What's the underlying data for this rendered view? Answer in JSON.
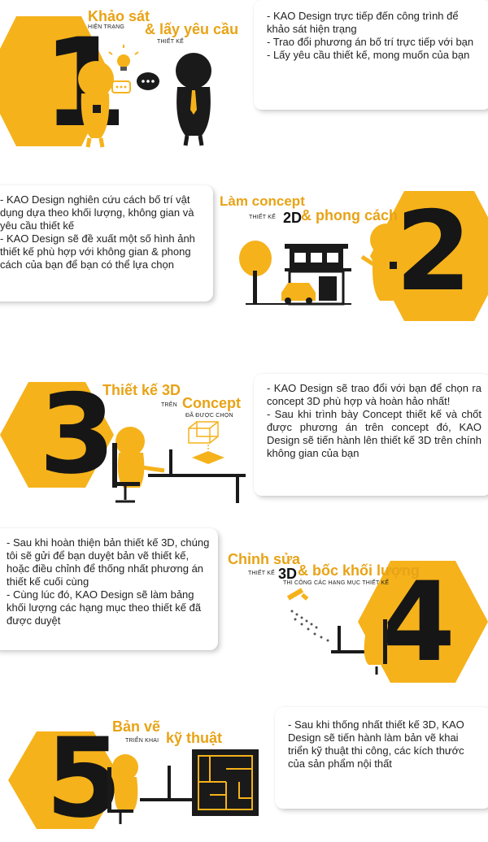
{
  "colors": {
    "accent": "#f5b21b",
    "title": "#e8a316",
    "dark": "#161616"
  },
  "steps": [
    {
      "number": "1",
      "title_main": "Khảo sát",
      "title_sub1": "HIỆN TRẠNG",
      "title_main2": "& lấy yêu cầu",
      "title_sub2": "THIẾT KẾ",
      "lines": [
        "-  KAO Design trực tiếp đến công trình để khảo sát hiện trạng",
        "- Trao đổi phương án bố trí trực tiếp với bạn",
        "- Lấy yêu cầu thiết kế, mong muốn của bạn"
      ]
    },
    {
      "number": "2",
      "title_main": "Làm concept",
      "title_sub1": "THIẾT KẾ",
      "title_main2": "2D",
      "title_main3": "& phong cách",
      "lines": [
        "- KAO Design nghiên cứu cách bố trí vật dụng dựa theo khối lượng, không gian và yêu cầu thiết kế",
        "- KAO Design sẽ đề xuất một số hình ảnh thiết kế phù hợp với không gian & phong cách của bạn để bạn có thể lựa chọn"
      ]
    },
    {
      "number": "3",
      "title_main": "Thiết kế 3D",
      "title_sub1": "TRÊN",
      "title_main2": "Concept",
      "title_sub2": "ĐÃ ĐƯỢC CHỌN",
      "lines": [
        "- KAO Design sẽ trao đổi với bạn để chọn ra concept 3D phù hợp và hoàn hảo nhất!",
        "- Sau khi trình bày Concept thiết kế và chốt được phương án trên concept đó, KAO Design sẽ tiến hành lên thiết kế 3D trên chính không gian của bạn"
      ]
    },
    {
      "number": "4",
      "title_main": "Chỉnh sửa",
      "title_sub1": "THIẾT KẾ",
      "title_main2": "3D",
      "title_main3": "& bốc khối lượng",
      "title_sub2": "THI CÔNG CÁC HẠNG MỤC THIẾT KẾ",
      "lines": [
        "- Sau khi hoàn thiện bản thiết kế 3D, chúng tôi sẽ gửi để bạn duyệt bản vẽ thiết kế, hoặc điều chỉnh để thống nhất phương án thiết kế cuối cùng",
        "-  Cùng lúc đó, KAO Design sẽ làm bảng khối lượng các hạng mục theo thiết kế đã được duyệt"
      ]
    },
    {
      "number": "5",
      "title_main": "Bản vẽ",
      "title_sub1": "TRIỂN KHAI",
      "title_main2": "kỹ thuật",
      "lines": [
        "- Sau khi thống nhất thiết kế 3D, KAO Design sẽ tiến hành làm bản vẽ khai triển kỹ thuật thi công, các kích thước của sản phẩm nội thất"
      ]
    }
  ]
}
